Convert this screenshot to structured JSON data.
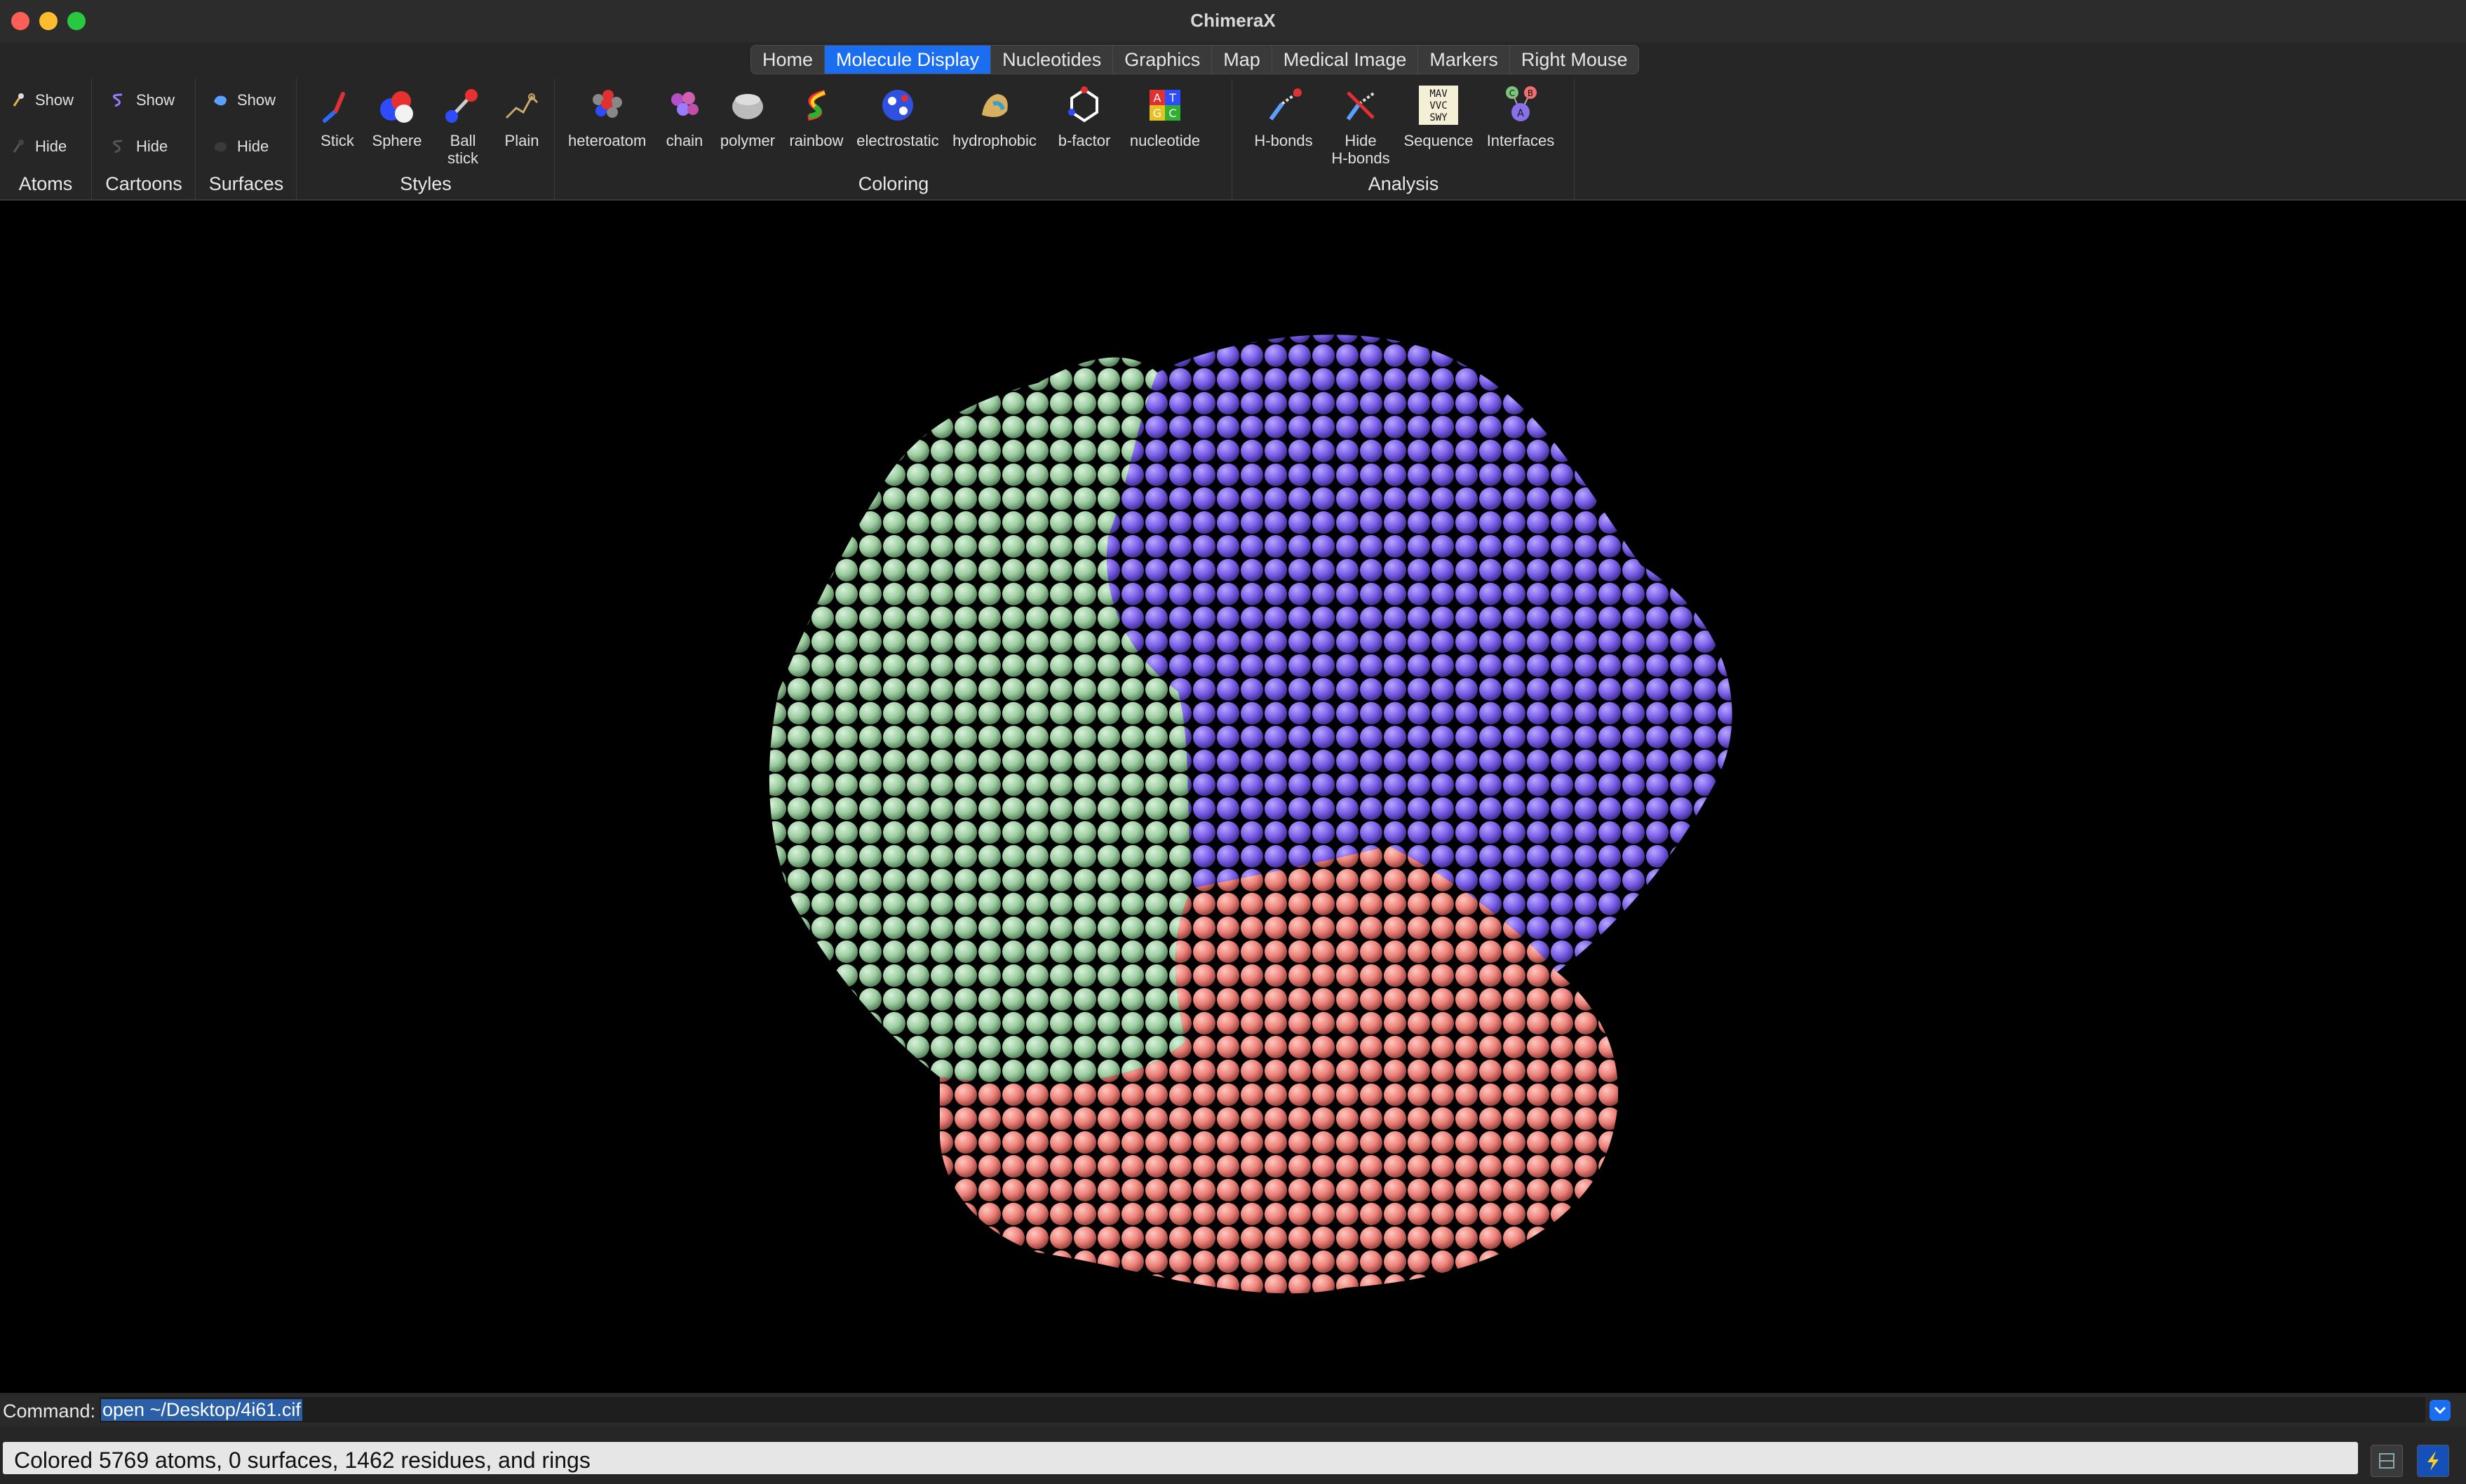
{
  "window": {
    "title": "ChimeraX"
  },
  "tabs": [
    {
      "label": "Home"
    },
    {
      "label": "Molecule Display",
      "active": true
    },
    {
      "label": "Nucleotides"
    },
    {
      "label": "Graphics"
    },
    {
      "label": "Map"
    },
    {
      "label": "Medical Image"
    },
    {
      "label": "Markers"
    },
    {
      "label": "Right Mouse"
    }
  ],
  "toolbar": {
    "atoms": {
      "show": "Show",
      "hide": "Hide",
      "label": "Atoms"
    },
    "cartoons": {
      "show": "Show",
      "hide": "Hide",
      "label": "Cartoons"
    },
    "surfaces": {
      "show": "Show",
      "hide": "Hide",
      "label": "Surfaces"
    },
    "styles": {
      "label": "Styles",
      "stick": "Stick",
      "sphere": "Sphere",
      "ballstick_1": "Ball",
      "ballstick_2": "stick",
      "plain": "Plain"
    },
    "coloring": {
      "label": "Coloring",
      "heteroatom": "heteroatom",
      "chain": "chain",
      "polymer": "polymer",
      "rainbow": "rainbow",
      "electrostatic": "electrostatic",
      "hydrophobic": "hydrophobic",
      "bfactor": "b-factor",
      "nucleotide": "nucleotide"
    },
    "analysis": {
      "label": "Analysis",
      "hbonds": "H-bonds",
      "hide_hbonds_1": "Hide",
      "hide_hbonds_2": "H-bonds",
      "sequence": "Sequence",
      "interfaces": "Interfaces"
    }
  },
  "icons": {
    "nucleotide_letters": [
      "A",
      "T",
      "G",
      "C"
    ],
    "sequence_letters": [
      "MAV",
      "VVC",
      "SWY"
    ],
    "interfaces_letters": [
      "C",
      "B",
      "A"
    ]
  },
  "command": {
    "label": "Command:",
    "value": "open ~/Desktop/4i61.cif"
  },
  "status": {
    "message": "Colored 5769 atoms, 0 surfaces, 1462 residues, and rings"
  },
  "colors": {
    "accent": "#1b6ef0",
    "chain_a": "#9370db",
    "chain_b": "#8fc797",
    "chain_c": "#f08080"
  }
}
